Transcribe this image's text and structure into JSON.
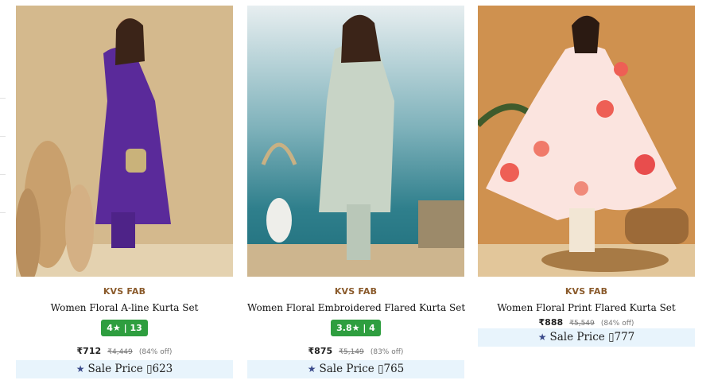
{
  "products": [
    {
      "brand": "KVS FAB",
      "title": "Women Floral A-line Kurta Set",
      "rating": "4★ | 13",
      "price": "₹712",
      "mrp": "₹4,449",
      "discount": "(84% off)",
      "sale_label": "Sale Price ▯623",
      "star_icon": "star-icon",
      "colors": {
        "background": "#d8bf96",
        "kurta": "#5a2a9a"
      }
    },
    {
      "brand": "KVS FAB",
      "title": "Women Floral Embroidered Flared Kurta Set",
      "rating": "3.8★ | 4",
      "price": "₹875",
      "mrp": "₹5,149",
      "discount": "(83% off)",
      "sale_label": "Sale Price ▯765",
      "star_icon": "star-icon",
      "colors": {
        "background": "#2f7f8c",
        "kurta": "#c8d4c6"
      }
    },
    {
      "brand": "KVS FAB",
      "title": "Women Floral Print Flared Kurta Set",
      "price": "₹888",
      "mrp": "₹5,549",
      "discount": "(84% off)",
      "sale_label": "Sale Price ▯777",
      "star_icon": "star-icon",
      "colors": {
        "background": "#c98844",
        "kurta": "#fbe4df"
      }
    }
  ],
  "colors": {
    "rating_badge": "#2e9e3f",
    "brand_text": "#8a5a2b",
    "sale_banner": "#e8f4fc"
  }
}
